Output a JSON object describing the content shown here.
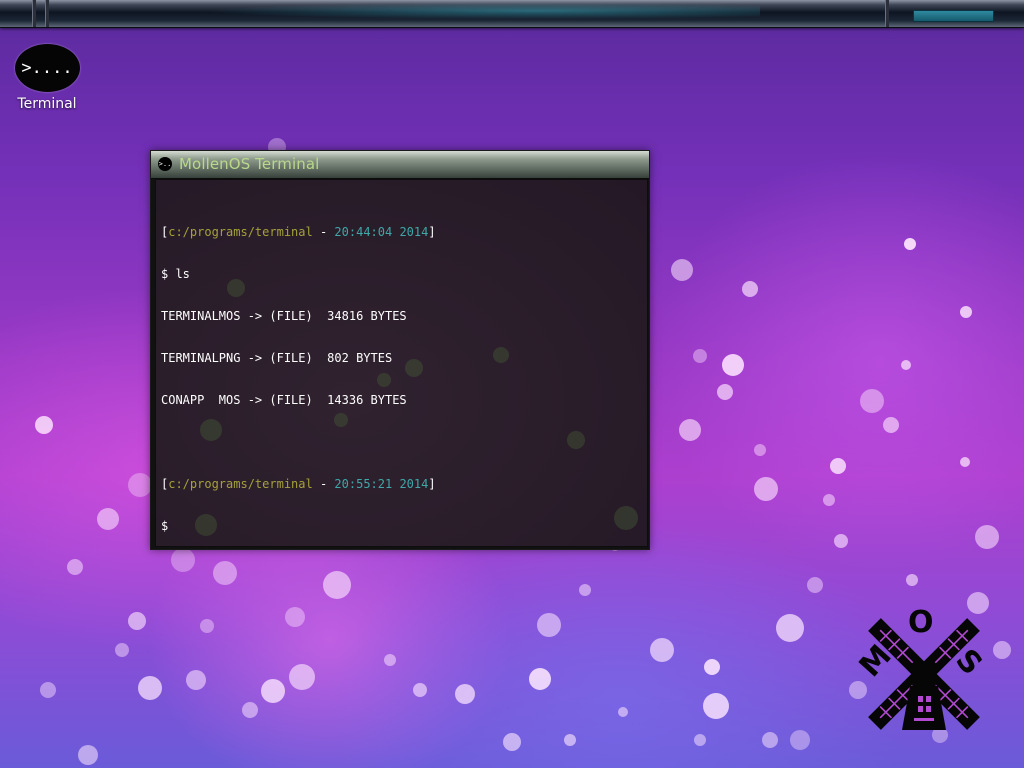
{
  "panel": {
    "accent": "#1d6e82"
  },
  "desktop": {
    "icons": [
      {
        "glyph": ">....",
        "label": "Terminal",
        "icon": "terminal-icon"
      }
    ]
  },
  "terminal": {
    "title": "MollenOS Terminal",
    "app_icon_glyph": ">..",
    "colors": {
      "path": "#a4a13a",
      "time": "#3fa7a7",
      "text": "#ffffff"
    },
    "sessions": [
      {
        "path": "c:/programs/terminal",
        "separator": " - ",
        "time": "20:44:04 2014",
        "command": "$ ls",
        "output": [
          "TERMINALMOS -> (FILE)  34816 BYTES",
          "TERMINALPNG -> (FILE)  802 BYTES",
          "CONAPP  MOS -> (FILE)  14336 BYTES"
        ]
      },
      {
        "path": "c:/programs/terminal",
        "separator": " - ",
        "time": "20:55:21 2014",
        "command": "$",
        "output": []
      }
    ]
  },
  "logo": {
    "text": "MOS",
    "icon": "mollenos-windmill-logo"
  }
}
